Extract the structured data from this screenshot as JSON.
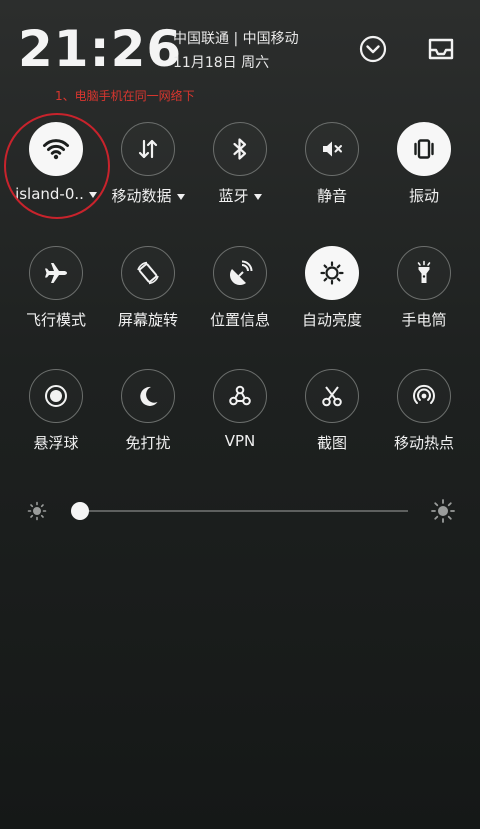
{
  "status": {
    "time": "21:26",
    "carriers": "中国联通 | 中国移动",
    "date": "11月18日 周六"
  },
  "header_icons": {
    "expand": "chevron-down-circle-icon",
    "tray": "tray-icon"
  },
  "annotation": "1、电脑手机在同一网络下",
  "tiles": [
    {
      "label": "island-0..",
      "icon": "wifi-icon",
      "active": true,
      "caret": true
    },
    {
      "label": "移动数据",
      "icon": "mobile-data-icon",
      "active": false,
      "caret": true
    },
    {
      "label": "蓝牙",
      "icon": "bluetooth-icon",
      "active": false,
      "caret": true
    },
    {
      "label": "静音",
      "icon": "mute-icon",
      "active": false,
      "caret": false
    },
    {
      "label": "振动",
      "icon": "vibrate-icon",
      "active": true,
      "caret": false
    },
    {
      "label": "飞行模式",
      "icon": "airplane-icon",
      "active": false,
      "caret": false
    },
    {
      "label": "屏幕旋转",
      "icon": "rotate-icon",
      "active": false,
      "caret": false
    },
    {
      "label": "位置信息",
      "icon": "location-icon",
      "active": false,
      "caret": false
    },
    {
      "label": "自动亮度",
      "icon": "auto-brightness-icon",
      "active": true,
      "caret": false
    },
    {
      "label": "手电筒",
      "icon": "flashlight-icon",
      "active": false,
      "caret": false
    },
    {
      "label": "悬浮球",
      "icon": "floating-ball-icon",
      "active": false,
      "caret": false
    },
    {
      "label": "免打扰",
      "icon": "moon-icon",
      "active": false,
      "caret": false
    },
    {
      "label": "VPN",
      "icon": "vpn-icon",
      "active": false,
      "caret": false
    },
    {
      "label": "截图",
      "icon": "scissors-icon",
      "active": false,
      "caret": false
    },
    {
      "label": "移动热点",
      "icon": "hotspot-icon",
      "active": false,
      "caret": false
    }
  ],
  "brightness": {
    "level": 0.0
  },
  "colors": {
    "annotation_red": "#c8232c",
    "active_tile": "#f7f7f7"
  }
}
